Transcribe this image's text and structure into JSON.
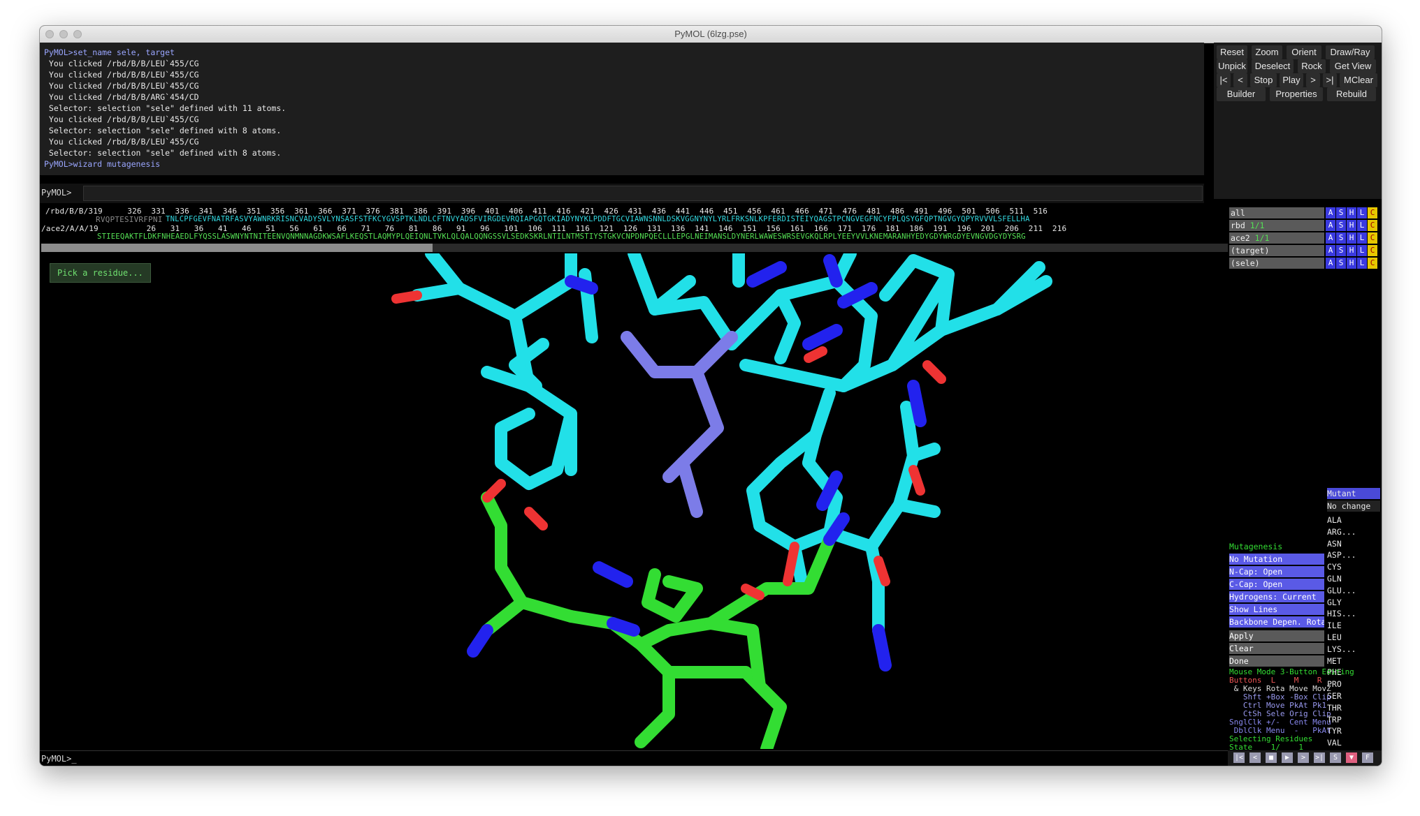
{
  "window": {
    "title": "PyMOL (6lzg.pse)"
  },
  "console": {
    "lines": [
      {
        "text": "PyMOL>set_name sele, target",
        "color": "#9aa6ff"
      },
      {
        "text": " You clicked /rbd/B/B/LEU`455/CG",
        "color": "#e8e8e8"
      },
      {
        "text": " You clicked /rbd/B/B/LEU`455/CG",
        "color": "#e8e8e8"
      },
      {
        "text": " You clicked /rbd/B/B/LEU`455/CG",
        "color": "#e8e8e8"
      },
      {
        "text": " You clicked /rbd/B/B/ARG`454/CD",
        "color": "#e8e8e8"
      },
      {
        "text": " Selector: selection \"sele\" defined with 11 atoms.",
        "color": "#e8e8e8"
      },
      {
        "text": " You clicked /rbd/B/B/LEU`455/CG",
        "color": "#e8e8e8"
      },
      {
        "text": " Selector: selection \"sele\" defined with 8 atoms.",
        "color": "#e8e8e8"
      },
      {
        "text": " You clicked /rbd/B/B/LEU`455/CG",
        "color": "#e8e8e8"
      },
      {
        "text": " Selector: selection \"sele\" defined with 8 atoms.",
        "color": "#e8e8e8"
      },
      {
        "text": "PyMOL>wizard mutagenesis",
        "color": "#9aa6ff"
      }
    ],
    "prompt": "PyMOL>"
  },
  "buttons": {
    "row1": [
      "Reset",
      "Zoom",
      "Orient",
      "Draw/Ray"
    ],
    "row2": [
      "Unpick",
      "Deselect",
      "Rock",
      "Get View"
    ],
    "row3": [
      "|<",
      "<",
      "Stop",
      "Play",
      ">",
      ">|",
      "MClear"
    ],
    "row4": [
      "Builder",
      "Properties",
      "Rebuild"
    ]
  },
  "sequence": {
    "rbd_label": "/rbd/B/B/319",
    "rbd_numbers": "    326  331  336  341  346  351  356  361  366  371  376  381  386  391  396  401  406  411  416  421  426  431  436  441  446  451  456  461  466  471  476  481  486  491  496  501  506  511  516",
    "rbd_seq_gray": "RVQPTESIVRFPNI",
    "rbd_seq": "TNLCPFGEVFNATRFASVYAWNRKRISNCVADYSVLYNSASFSTFKCYGVSPTKLNDLCFTNVYADSFVIRGDEVRQIAPGQTGKIADYNYKLPDDFTGCVIAWNSNNLDSKVGGNYNYLYRLFRKSNLKPFERDISTEIYQAGSTPCNGVEGFNCYFPLQSYGFQPTNGVGYQPYRVVVLSFELLHA",
    "ace2_label": "/ace2/A/A/19",
    "ace2_numbers": "        26   31   36   41   46   51   56   61   66   71   76   81   86   91   96   101  106  111  116  121  126  131  136  141  146  151  156  161  166  171  176  181  186  191  196  201  206  211  216",
    "ace2_seq": "STIEEQAKTFLDKFNHEAEDLFYQSSLASWNYNTNITEENVQNMNNAGDKWSAFLKEQSTLAQMYPLQEIQNLTVKLQLQALQQNGSSVLSEDKSKRLNTILNTMSTIYSTGKVCNPDNPQECLLLEPGLNEIMANSLDYNERLWAWESWRSEVGKQLRPLYEEYVVLKNEMARANHYEDYGDYWRGDYEVNGVDGYDYSRG"
  },
  "viewer": {
    "pick_message": "Pick a residue..."
  },
  "objects": [
    {
      "name": "all",
      "suffix": ""
    },
    {
      "name": "rbd",
      "suffix": " 1/1"
    },
    {
      "name": "ace2",
      "suffix": " 1/1"
    },
    {
      "name": "(target)",
      "suffix": ""
    },
    {
      "name": "(sele)",
      "suffix": ""
    }
  ],
  "object_buttons": [
    "A",
    "S",
    "H",
    "L",
    "C"
  ],
  "wizard": {
    "title": "Mutagenesis",
    "items": [
      "No Mutation",
      "N-Cap: Open",
      "C-Cap: Open",
      "Hydrogens: Current",
      "Show Lines",
      "Backbone Depen. Rotamers"
    ],
    "actions": [
      "Apply",
      "Clear",
      "Done"
    ]
  },
  "mutant_menu": {
    "title": "Mutant",
    "items": [
      "No change",
      "ALA",
      "ARG...",
      "ASN",
      "ASP...",
      "CYS",
      "GLN",
      "GLU...",
      "GLY",
      "HIS...",
      "ILE",
      "LEU",
      "LYS...",
      "MET",
      "PHE",
      "PRO",
      "SER",
      "THR",
      "TRP",
      "TYR",
      "VAL"
    ]
  },
  "mouse_mode": {
    "header": "Mouse Mode 3-Button Editing",
    "buttons_row": "Buttons  L    M    R",
    "keys_row": " & Keys Rota Move MovZ",
    "shft_row": "   Shft +Box -Box Clip",
    "ctrl_row": "   Ctrl Move PkAt Pk1",
    "ctsh_row": "   CtSh Sele Orig Clip",
    "snglclk_row": "SnglClk +/-  Cent Menu",
    "dblclk_row": " DblClk Menu  -   PkAt",
    "selecting": "Selecting Residues",
    "state": "State    1/    1"
  },
  "status": {
    "prompt": "PyMOL>_"
  },
  "playback_controls": [
    "|<",
    "<",
    "■",
    "▶",
    ">",
    ">|",
    "S",
    "▼",
    "F"
  ],
  "colors": {
    "cyan": "#22e0e8",
    "green": "#33dd33",
    "blue": "#2222ee",
    "red": "#ee3333",
    "slate": "#7c7ce8"
  }
}
